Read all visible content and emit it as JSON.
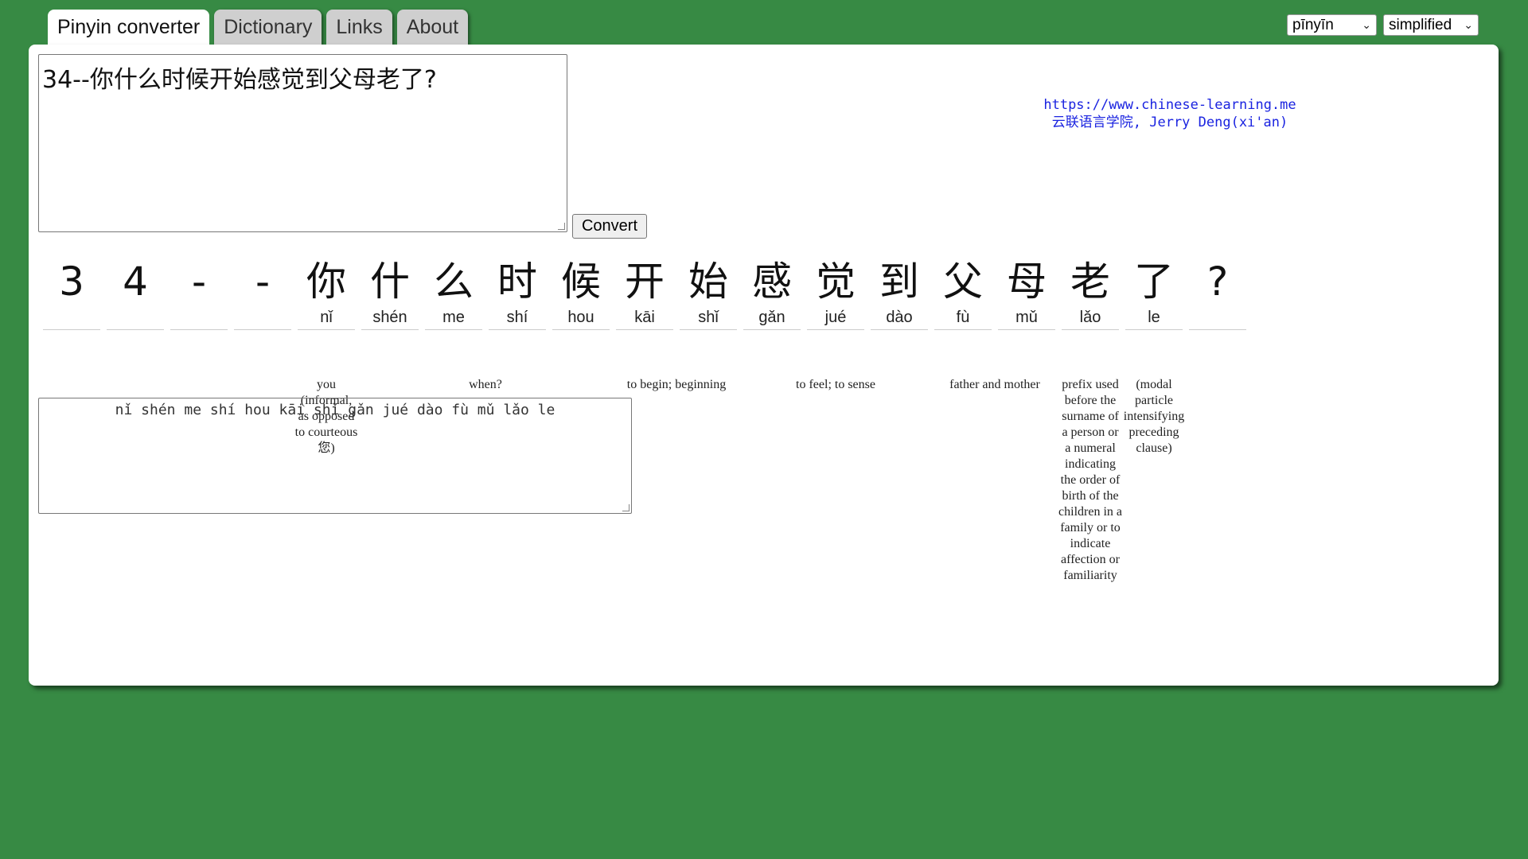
{
  "tabs": [
    {
      "label": "Pinyin converter",
      "active": true
    },
    {
      "label": "Dictionary"
    },
    {
      "label": "Links"
    },
    {
      "label": "About"
    }
  ],
  "mode_select": {
    "value": "pīnyīn"
  },
  "script_select": {
    "value": "simplified"
  },
  "input": {
    "text": "34--你什么时候开始感觉到父母老了?"
  },
  "convert_label": "Convert",
  "site": {
    "url": "https://www.chinese-learning.me",
    "credit": "云联语言学院, Jerry Deng(xi'an)"
  },
  "characters": [
    {
      "ch": "3",
      "py": ""
    },
    {
      "ch": "4",
      "py": ""
    },
    {
      "ch": "-",
      "py": ""
    },
    {
      "ch": "-",
      "py": ""
    },
    {
      "ch": "你",
      "py": "nǐ"
    },
    {
      "ch": "什",
      "py": "shén"
    },
    {
      "ch": "么",
      "py": "me"
    },
    {
      "ch": "时",
      "py": "shí"
    },
    {
      "ch": "候",
      "py": "hou"
    },
    {
      "ch": "开",
      "py": "kāi"
    },
    {
      "ch": "始",
      "py": "shǐ"
    },
    {
      "ch": "感",
      "py": "gǎn"
    },
    {
      "ch": "觉",
      "py": "jué"
    },
    {
      "ch": "到",
      "py": "dào"
    },
    {
      "ch": "父",
      "py": "fù"
    },
    {
      "ch": "母",
      "py": "mǔ"
    },
    {
      "ch": "老",
      "py": "lǎo"
    },
    {
      "ch": "了",
      "py": "le"
    },
    {
      "ch": "?",
      "py": ""
    }
  ],
  "definitions": [
    {
      "text": "you (informal, as opposed to courteous 您)"
    },
    {
      "text": "when?"
    },
    {
      "text": "to begin; beginning"
    },
    {
      "text": "to feel; to sense"
    },
    {
      "text": "father and mother"
    },
    {
      "text": "prefix used before the surname of a person or a numeral indicating the order of birth of the children in a family or to indicate affection or familiarity"
    },
    {
      "text": "(modal particle intensifying preceding clause)"
    }
  ],
  "output": {
    "text": "nǐ shén me shí hou kāi shǐ gǎn jué dào fù mǔ lǎo le"
  }
}
